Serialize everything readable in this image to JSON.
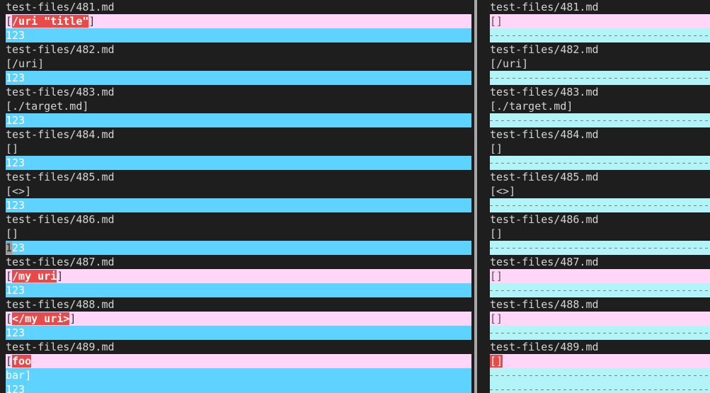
{
  "left": {
    "blocks": [
      {
        "header": "test-files/481.md",
        "pre": "[",
        "hl": "/uri \"title\"",
        "post": "]",
        "kind": "del",
        "tail": [
          "123"
        ]
      },
      {
        "header": "test-files/482.md",
        "pre": "[/uri]",
        "hl": "",
        "post": "",
        "kind": "hdr",
        "tail": [
          "123"
        ]
      },
      {
        "header": "test-files/483.md",
        "pre": "[./target.md]",
        "hl": "",
        "post": "",
        "kind": "hdr",
        "tail": [
          "123"
        ]
      },
      {
        "header": "test-files/484.md",
        "pre": "[]",
        "hl": "",
        "post": "",
        "kind": "hdr",
        "tail": [
          "123"
        ]
      },
      {
        "header": "test-files/485.md",
        "pre": "[<>]",
        "hl": "",
        "post": "",
        "kind": "hdr",
        "tail": [
          "123"
        ]
      },
      {
        "header": "test-files/486.md",
        "pre": "[]",
        "hl": "",
        "post": "",
        "kind": "hdr",
        "tail": [
          "123"
        ],
        "cursor": true
      },
      {
        "header": "test-files/487.md",
        "pre": "[",
        "hl": "/my uri",
        "post": "]",
        "kind": "del",
        "tail": [
          "123"
        ]
      },
      {
        "header": "test-files/488.md",
        "pre": "[",
        "hl": "</my uri>",
        "post": "]",
        "kind": "del",
        "tail": [
          "123"
        ]
      },
      {
        "header": "test-files/489.md",
        "pre": "[",
        "hl": "foo",
        "post": "",
        "kind": "del",
        "tail": [
          "bar]",
          "123"
        ]
      }
    ]
  },
  "right": {
    "blocks": [
      {
        "header": "test-files/481.md",
        "line": "[]",
        "kind": "del",
        "fillers": 1
      },
      {
        "header": "test-files/482.md",
        "line": "[/uri]",
        "kind": "hdr",
        "fillers": 1
      },
      {
        "header": "test-files/483.md",
        "line": "[./target.md]",
        "kind": "hdr",
        "fillers": 1
      },
      {
        "header": "test-files/484.md",
        "line": "[]",
        "kind": "hdr",
        "fillers": 1
      },
      {
        "header": "test-files/485.md",
        "line": "[<>]",
        "kind": "hdr",
        "fillers": 1
      },
      {
        "header": "test-files/486.md",
        "line": "[]",
        "kind": "hdr",
        "fillers": 1
      },
      {
        "header": "test-files/487.md",
        "line": "[]",
        "kind": "del",
        "fillers": 1
      },
      {
        "header": "test-files/488.md",
        "line": "[]",
        "kind": "del",
        "fillers": 1
      },
      {
        "header": "test-files/489.md",
        "line": "[]",
        "kind": "del-hl",
        "fillers": 2
      }
    ]
  }
}
